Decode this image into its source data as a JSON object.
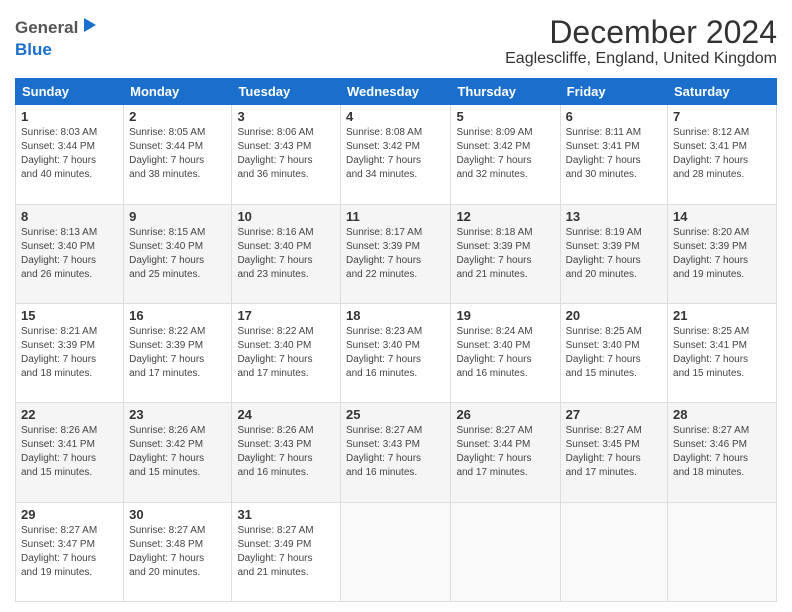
{
  "header": {
    "logo": {
      "general": "General",
      "blue": "Blue"
    },
    "title": "December 2024",
    "subtitle": "Eaglescliffe, England, United Kingdom"
  },
  "calendar": {
    "headers": [
      "Sunday",
      "Monday",
      "Tuesday",
      "Wednesday",
      "Thursday",
      "Friday",
      "Saturday"
    ],
    "weeks": [
      [
        {
          "day": "1",
          "info": "Sunrise: 8:03 AM\nSunset: 3:44 PM\nDaylight: 7 hours\nand 40 minutes."
        },
        {
          "day": "2",
          "info": "Sunrise: 8:05 AM\nSunset: 3:44 PM\nDaylight: 7 hours\nand 38 minutes."
        },
        {
          "day": "3",
          "info": "Sunrise: 8:06 AM\nSunset: 3:43 PM\nDaylight: 7 hours\nand 36 minutes."
        },
        {
          "day": "4",
          "info": "Sunrise: 8:08 AM\nSunset: 3:42 PM\nDaylight: 7 hours\nand 34 minutes."
        },
        {
          "day": "5",
          "info": "Sunrise: 8:09 AM\nSunset: 3:42 PM\nDaylight: 7 hours\nand 32 minutes."
        },
        {
          "day": "6",
          "info": "Sunrise: 8:11 AM\nSunset: 3:41 PM\nDaylight: 7 hours\nand 30 minutes."
        },
        {
          "day": "7",
          "info": "Sunrise: 8:12 AM\nSunset: 3:41 PM\nDaylight: 7 hours\nand 28 minutes."
        }
      ],
      [
        {
          "day": "8",
          "info": "Sunrise: 8:13 AM\nSunset: 3:40 PM\nDaylight: 7 hours\nand 26 minutes."
        },
        {
          "day": "9",
          "info": "Sunrise: 8:15 AM\nSunset: 3:40 PM\nDaylight: 7 hours\nand 25 minutes."
        },
        {
          "day": "10",
          "info": "Sunrise: 8:16 AM\nSunset: 3:40 PM\nDaylight: 7 hours\nand 23 minutes."
        },
        {
          "day": "11",
          "info": "Sunrise: 8:17 AM\nSunset: 3:39 PM\nDaylight: 7 hours\nand 22 minutes."
        },
        {
          "day": "12",
          "info": "Sunrise: 8:18 AM\nSunset: 3:39 PM\nDaylight: 7 hours\nand 21 minutes."
        },
        {
          "day": "13",
          "info": "Sunrise: 8:19 AM\nSunset: 3:39 PM\nDaylight: 7 hours\nand 20 minutes."
        },
        {
          "day": "14",
          "info": "Sunrise: 8:20 AM\nSunset: 3:39 PM\nDaylight: 7 hours\nand 19 minutes."
        }
      ],
      [
        {
          "day": "15",
          "info": "Sunrise: 8:21 AM\nSunset: 3:39 PM\nDaylight: 7 hours\nand 18 minutes."
        },
        {
          "day": "16",
          "info": "Sunrise: 8:22 AM\nSunset: 3:39 PM\nDaylight: 7 hours\nand 17 minutes."
        },
        {
          "day": "17",
          "info": "Sunrise: 8:22 AM\nSunset: 3:40 PM\nDaylight: 7 hours\nand 17 minutes."
        },
        {
          "day": "18",
          "info": "Sunrise: 8:23 AM\nSunset: 3:40 PM\nDaylight: 7 hours\nand 16 minutes."
        },
        {
          "day": "19",
          "info": "Sunrise: 8:24 AM\nSunset: 3:40 PM\nDaylight: 7 hours\nand 16 minutes."
        },
        {
          "day": "20",
          "info": "Sunrise: 8:25 AM\nSunset: 3:40 PM\nDaylight: 7 hours\nand 15 minutes."
        },
        {
          "day": "21",
          "info": "Sunrise: 8:25 AM\nSunset: 3:41 PM\nDaylight: 7 hours\nand 15 minutes."
        }
      ],
      [
        {
          "day": "22",
          "info": "Sunrise: 8:26 AM\nSunset: 3:41 PM\nDaylight: 7 hours\nand 15 minutes."
        },
        {
          "day": "23",
          "info": "Sunrise: 8:26 AM\nSunset: 3:42 PM\nDaylight: 7 hours\nand 15 minutes."
        },
        {
          "day": "24",
          "info": "Sunrise: 8:26 AM\nSunset: 3:43 PM\nDaylight: 7 hours\nand 16 minutes."
        },
        {
          "day": "25",
          "info": "Sunrise: 8:27 AM\nSunset: 3:43 PM\nDaylight: 7 hours\nand 16 minutes."
        },
        {
          "day": "26",
          "info": "Sunrise: 8:27 AM\nSunset: 3:44 PM\nDaylight: 7 hours\nand 17 minutes."
        },
        {
          "day": "27",
          "info": "Sunrise: 8:27 AM\nSunset: 3:45 PM\nDaylight: 7 hours\nand 17 minutes."
        },
        {
          "day": "28",
          "info": "Sunrise: 8:27 AM\nSunset: 3:46 PM\nDaylight: 7 hours\nand 18 minutes."
        }
      ],
      [
        {
          "day": "29",
          "info": "Sunrise: 8:27 AM\nSunset: 3:47 PM\nDaylight: 7 hours\nand 19 minutes."
        },
        {
          "day": "30",
          "info": "Sunrise: 8:27 AM\nSunset: 3:48 PM\nDaylight: 7 hours\nand 20 minutes."
        },
        {
          "day": "31",
          "info": "Sunrise: 8:27 AM\nSunset: 3:49 PM\nDaylight: 7 hours\nand 21 minutes."
        },
        {
          "day": "",
          "info": ""
        },
        {
          "day": "",
          "info": ""
        },
        {
          "day": "",
          "info": ""
        },
        {
          "day": "",
          "info": ""
        }
      ]
    ]
  }
}
